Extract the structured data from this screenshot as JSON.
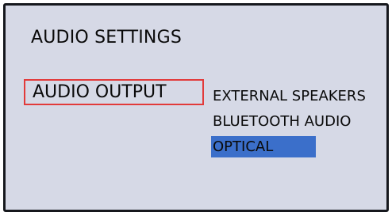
{
  "screen": {
    "title": "AUDIO SETTINGS"
  },
  "menu": {
    "label": "AUDIO OUTPUT",
    "options": [
      {
        "label": "EXTERNAL SPEAKERS",
        "selected": false
      },
      {
        "label": "BLUETOOTH AUDIO",
        "selected": false
      },
      {
        "label": "OPTICAL",
        "selected": true
      }
    ]
  },
  "colors": {
    "background": "#d6d9e6",
    "focus_border": "#e23a3a",
    "selection_highlight": "#3b6fca"
  }
}
